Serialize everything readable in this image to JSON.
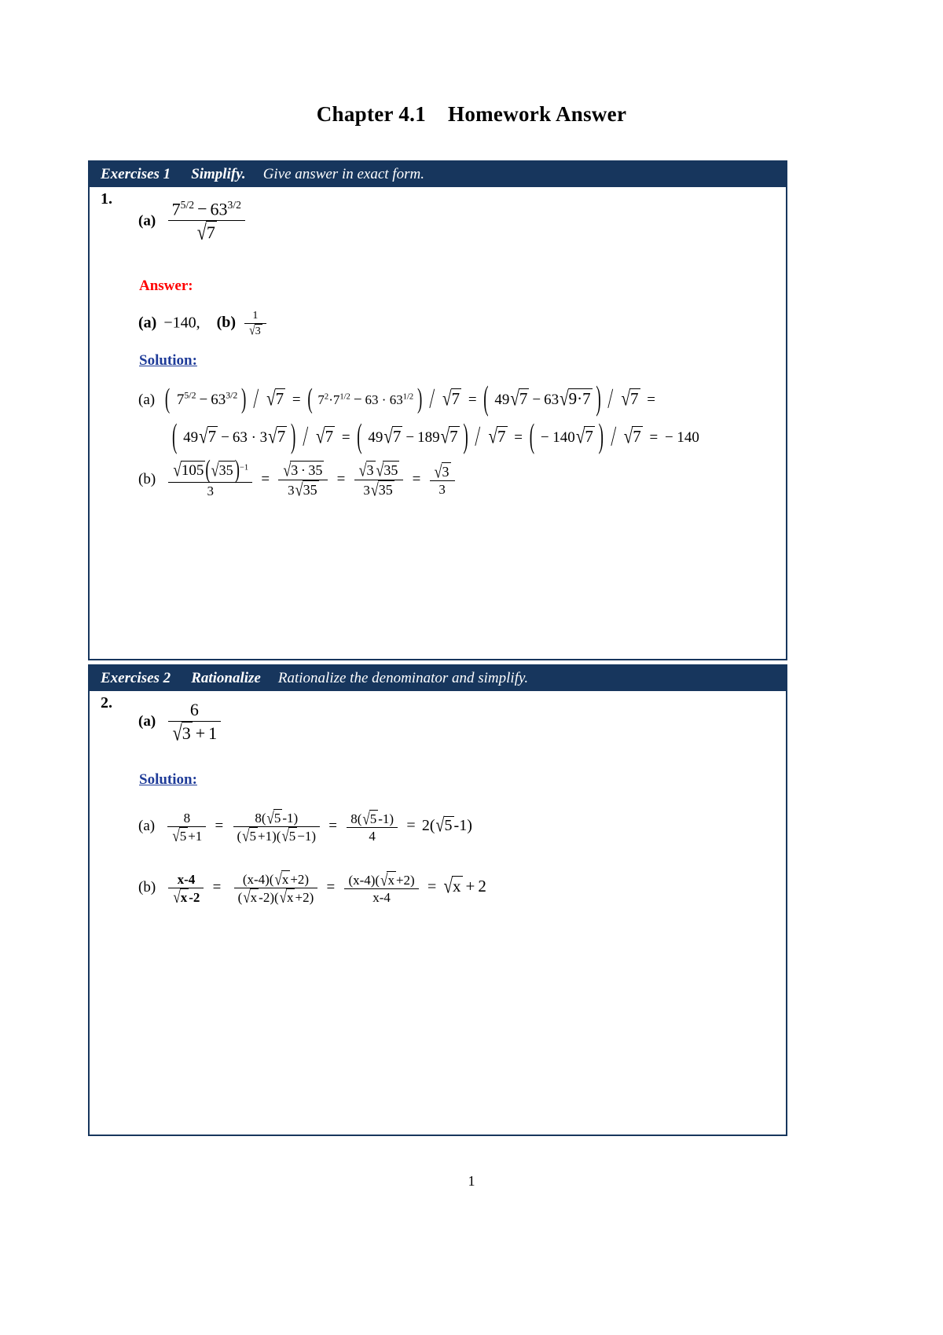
{
  "document": {
    "title_main": "Chapter 4.1",
    "title_sub": "Homework Answer",
    "page_number": "1"
  },
  "theme": {
    "header_bg": "#17365D",
    "header_text": "#FFFFFF",
    "answer_color": "#FF0000",
    "solution_color": "#1F3C99",
    "border_color": "#17365D"
  },
  "exercises": [
    {
      "header": {
        "number": "Exercises 1",
        "verb": "Simplify.",
        "description": "Give answer in exact form."
      },
      "problem_number": "1.",
      "problem": {
        "part_label": "(a)",
        "numerator": "7^(5/2) − 63^(3/2)",
        "denominator": "√7",
        "plain": "(a) (7^(5/2) − 63^(3/2)) / √7"
      },
      "answer_label": "Answer:",
      "answer": {
        "part_a": "(a) −140,",
        "part_b": "(b) 1/√3",
        "a_label": "(a)",
        "a_value": "−140,",
        "b_label": "(b)",
        "b_num": "1",
        "b_den": "√3"
      },
      "solution_label": "Solution:",
      "solution": {
        "line_a_1": "(a) ( 7^(5/2) − 63^(3/2) ) / √7 = ( 7²·7^(1/2) − 63 · 63^(1/2) ) / √7 = ( 49√7 − 63√(9·7) ) / √7 =",
        "line_a_2": "( 49√7 − 63 · 3√7 ) / √7 = ( 49√7 − 189√7 ) / √7 = ( − 140√7 ) / √7 = − 140",
        "line_b": "(b) √105(√35)^−1 / 3 = √(3·35) / (3√35) = √3√35 / (3√35) = √3 / 3"
      }
    },
    {
      "header": {
        "number": "Exercises 2",
        "verb": "Rationalize",
        "description": "Rationalize the denominator and simplify."
      },
      "problem_number": "2.",
      "problem": {
        "part_label": "(a)",
        "numerator": "6",
        "denominator": "√3 + 1",
        "plain": "(a) 6 / (√3 + 1)"
      },
      "solution_label": "Solution:",
      "solution": {
        "line_a": "(a) 8/(√5+1) = 8(√5-1)/((√5+1)(√5−1)) = 8(√5-1)/4 = 2(√5-1)",
        "line_b": "(b) (x-4)/(√x-2) = (x-4)(√x+2)/((√x-2)(√x+2)) = (x-4)(√x+2)/(x-4) = √x + 2"
      }
    }
  ]
}
